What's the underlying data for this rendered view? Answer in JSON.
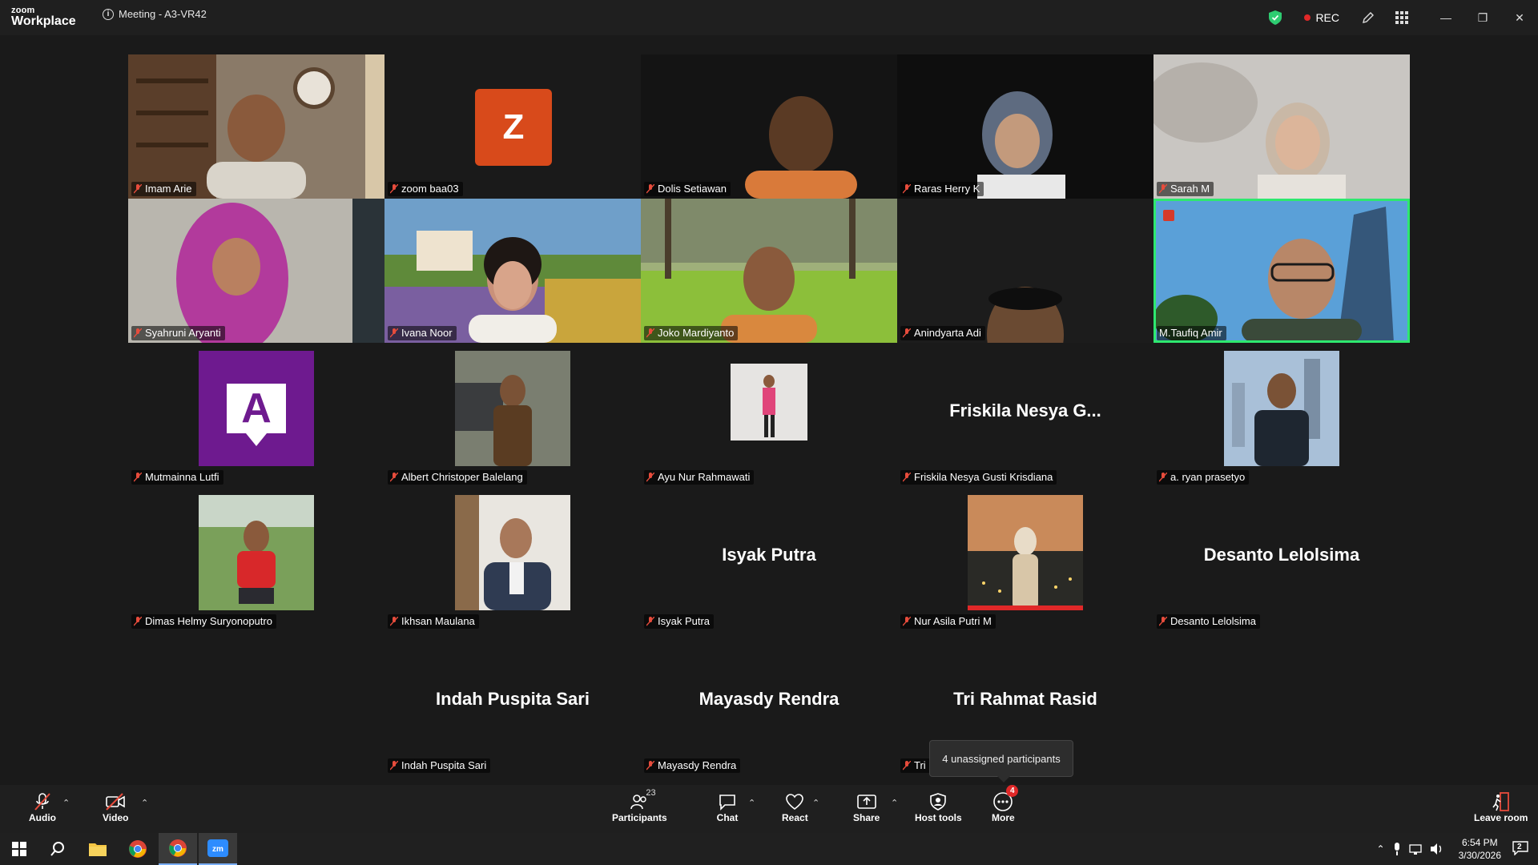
{
  "titlebar": {
    "logo_top": "zoom",
    "logo_bottom": "Workplace",
    "meeting_title": "Meeting - A3-VR42",
    "rec_label": "REC"
  },
  "tiles": [
    {
      "name": "Imam Arie",
      "kind": "video"
    },
    {
      "name": "zoom baa03",
      "kind": "avatar",
      "initial": "Z"
    },
    {
      "name": "Dolis Setiawan",
      "kind": "video"
    },
    {
      "name": "Raras Herry K",
      "kind": "video"
    },
    {
      "name": "Sarah M",
      "kind": "video"
    },
    {
      "name": "Syahruni Aryanti",
      "kind": "video"
    },
    {
      "name": "Ivana Noor",
      "kind": "video"
    },
    {
      "name": "Joko Mardiyanto",
      "kind": "video"
    },
    {
      "name": "Anindyarta Adi",
      "kind": "video"
    },
    {
      "name": "M.Taufiq Amir",
      "kind": "video",
      "active": true
    },
    {
      "name": "Mutmainna Lutfi",
      "kind": "avatar",
      "initial": "A"
    },
    {
      "name": "Albert Christoper Balelang",
      "kind": "photo"
    },
    {
      "name": "Ayu Nur Rahmawati",
      "kind": "photo"
    },
    {
      "name": "Friskila Nesya Gusti Krisdiana",
      "kind": "text",
      "display": "Friskila Nesya G..."
    },
    {
      "name": "a. ryan prasetyo",
      "kind": "photo"
    },
    {
      "name": "Dimas Helmy Suryonoputro",
      "kind": "photo"
    },
    {
      "name": "Ikhsan Maulana",
      "kind": "photo"
    },
    {
      "name": "Isyak Putra",
      "kind": "text",
      "display": "Isyak Putra"
    },
    {
      "name": "Nur Asila Putri M",
      "kind": "photo"
    },
    {
      "name": "Desanto Lelolsima",
      "kind": "text",
      "display": "Desanto Lelolsima"
    },
    {
      "name": "Indah Puspita Sari",
      "kind": "text",
      "display": "Indah Puspita Sari"
    },
    {
      "name": "Mayasdy Rendra",
      "kind": "text",
      "display": "Mayasdy Rendra"
    },
    {
      "name": "Tri",
      "kind": "text",
      "display": "Tri Rahmat Rasid"
    }
  ],
  "tooltip": "4 unassigned participants",
  "toolbar": {
    "audio": "Audio",
    "video": "Video",
    "participants": "Participants",
    "participants_count": "23",
    "chat": "Chat",
    "react": "React",
    "share": "Share",
    "host_tools": "Host tools",
    "more": "More",
    "more_badge": "4",
    "leave": "Leave room"
  },
  "taskbar": {
    "time": "6:54 PM",
    "date": "3/30/2026",
    "notif_count": "2"
  },
  "colors": {
    "active_border": "#2ee86f",
    "rec": "#e02828",
    "avatar_z": "#d84a1b",
    "avatar_a": "#6e1a8f"
  }
}
